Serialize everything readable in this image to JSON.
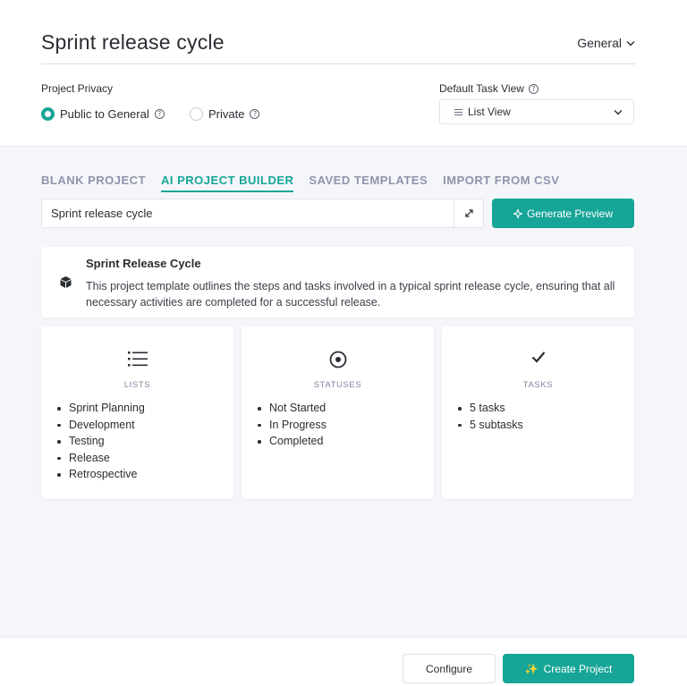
{
  "header": {
    "title": "Sprint release cycle",
    "space_select": "General"
  },
  "privacy": {
    "label": "Project Privacy",
    "options": [
      {
        "label": "Public to General",
        "selected": true
      },
      {
        "label": "Private",
        "selected": false
      }
    ]
  },
  "task_view": {
    "label": "Default Task View",
    "value": "List View"
  },
  "tabs": [
    {
      "label": "BLANK PROJECT",
      "active": false
    },
    {
      "label": "AI PROJECT BUILDER",
      "active": true
    },
    {
      "label": "SAVED TEMPLATES",
      "active": false
    },
    {
      "label": "IMPORT FROM CSV",
      "active": false
    }
  ],
  "prompt": {
    "value": "Sprint release cycle",
    "generate_label": "Generate Preview"
  },
  "summary": {
    "title": "Sprint Release Cycle",
    "description": "This project template outlines the steps and tasks involved in a typical sprint release cycle, ensuring that all necessary activities are completed for a successful release."
  },
  "cards": {
    "lists": {
      "heading": "LISTS",
      "icon": "list-icon",
      "items": [
        "Sprint Planning",
        "Development",
        "Testing",
        "Release",
        "Retrospective"
      ]
    },
    "statuses": {
      "heading": "STATUSES",
      "icon": "target-icon",
      "items": [
        "Not Started",
        "In Progress",
        "Completed"
      ]
    },
    "tasks": {
      "heading": "TASKS",
      "icon": "check-icon",
      "items": [
        "5 tasks",
        "5 subtasks"
      ]
    }
  },
  "footer": {
    "configure_label": "Configure",
    "create_label": "Create Project"
  },
  "colors": {
    "accent": "#17a597",
    "tab_inactive": "#8e95ab",
    "background": "#f5f6fa"
  }
}
